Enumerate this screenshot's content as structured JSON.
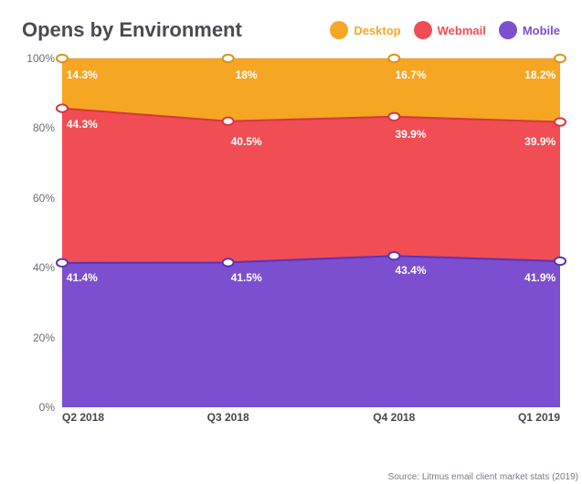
{
  "title": "Opens by Environment",
  "legend": [
    {
      "key": "desktop",
      "label": "Desktop",
      "color": "#F5A623"
    },
    {
      "key": "webmail",
      "label": "Webmail",
      "color": "#F04E54"
    },
    {
      "key": "mobile",
      "label": "Mobile",
      "color": "#7B4FD0"
    }
  ],
  "source": "Source: Litmus email client market stats (2019)",
  "chart_data": {
    "type": "area",
    "stacked": true,
    "categories": [
      "Q2 2018",
      "Q3 2018",
      "Q4 2018",
      "Q1 2019"
    ],
    "y_ticks": [
      "0%",
      "20%",
      "40%",
      "60%",
      "80%",
      "100%"
    ],
    "ylim": [
      0,
      100
    ],
    "series": [
      {
        "name": "Mobile",
        "color": "#7B4FD0",
        "values": [
          41.4,
          41.5,
          43.4,
          41.9
        ]
      },
      {
        "name": "Webmail",
        "color": "#F04E54",
        "values": [
          44.3,
          40.5,
          39.9,
          39.9
        ]
      },
      {
        "name": "Desktop",
        "color": "#F5A623",
        "values": [
          14.3,
          18.0,
          16.7,
          18.2
        ]
      }
    ],
    "data_labels": {
      "mobile": [
        "41.4%",
        "41.5%",
        "43.4%",
        "41.9%"
      ],
      "webmail": [
        "44.3%",
        "40.5%",
        "39.9%",
        "39.9%"
      ],
      "desktop": [
        "14.3%",
        "18%",
        "16.7%",
        "18.2%"
      ]
    }
  }
}
